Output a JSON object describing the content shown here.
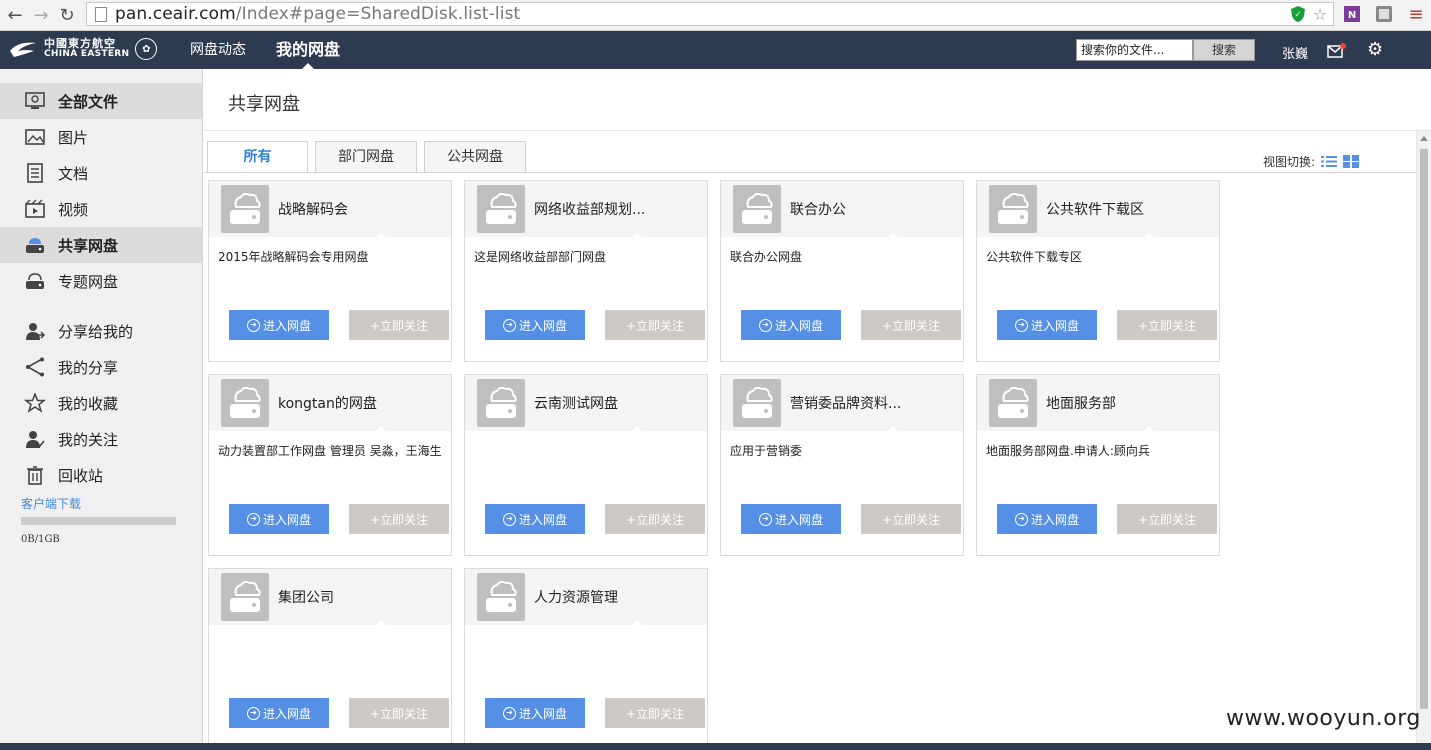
{
  "browser": {
    "url_host": "pan.ceair.com",
    "url_path": "/Index#page=SharedDisk.list-list"
  },
  "header": {
    "logo_cn": "中國東方航空",
    "logo_en": "CHINA EASTERN",
    "nav": [
      {
        "label": "网盘动态",
        "active": false
      },
      {
        "label": "我的网盘",
        "active": true
      }
    ],
    "search_placeholder": "搜索你的文件...",
    "search_button": "搜索",
    "username": "张巍"
  },
  "sidebar": {
    "items": [
      {
        "label": "全部文件",
        "icon": "all-files-icon",
        "active": true
      },
      {
        "label": "图片",
        "icon": "image-icon",
        "active": false
      },
      {
        "label": "文档",
        "icon": "document-icon",
        "active": false
      },
      {
        "label": "视频",
        "icon": "video-icon",
        "active": false
      },
      {
        "label": "共享网盘",
        "icon": "shared-disk-icon",
        "active": true
      },
      {
        "label": "专题网盘",
        "icon": "topic-disk-icon",
        "active": false
      }
    ],
    "items2": [
      {
        "label": "分享给我的",
        "icon": "shared-to-me-icon"
      },
      {
        "label": "我的分享",
        "icon": "share-icon"
      },
      {
        "label": "我的收藏",
        "icon": "star-icon"
      },
      {
        "label": "我的关注",
        "icon": "follow-icon"
      },
      {
        "label": "回收站",
        "icon": "trash-icon"
      }
    ],
    "client_download": "客户端下载",
    "quota": "0B/1GB",
    "quota_used_fraction": 0
  },
  "main": {
    "title": "共享网盘",
    "tabs": [
      {
        "label": "所有",
        "active": true
      },
      {
        "label": "部门网盘",
        "active": false
      },
      {
        "label": "公共网盘",
        "active": false
      }
    ],
    "view_switch_label": "视图切换:",
    "enter_label": "进入网盘",
    "follow_label": "+立即关注",
    "cards": [
      {
        "title": "战略解码会",
        "desc": "2015年战略解码会专用网盘"
      },
      {
        "title": "网络收益部规划...",
        "desc": "这是网络收益部部门网盘"
      },
      {
        "title": "联合办公",
        "desc": "联合办公网盘"
      },
      {
        "title": "公共软件下载区",
        "desc": "公共软件下载专区"
      },
      {
        "title": "kongtan的网盘",
        "desc": "动力装置部工作网盘 管理员 吴淼，王海生"
      },
      {
        "title": "云南测试网盘",
        "desc": ""
      },
      {
        "title": "营销委品牌资料...",
        "desc": "应用于营销委"
      },
      {
        "title": "地面服务部",
        "desc": "地面服务部网盘.申请人:顾向兵"
      },
      {
        "title": "集团公司",
        "desc": ""
      },
      {
        "title": "人力资源管理",
        "desc": ""
      }
    ]
  },
  "watermark": "www.wooyun.org"
}
